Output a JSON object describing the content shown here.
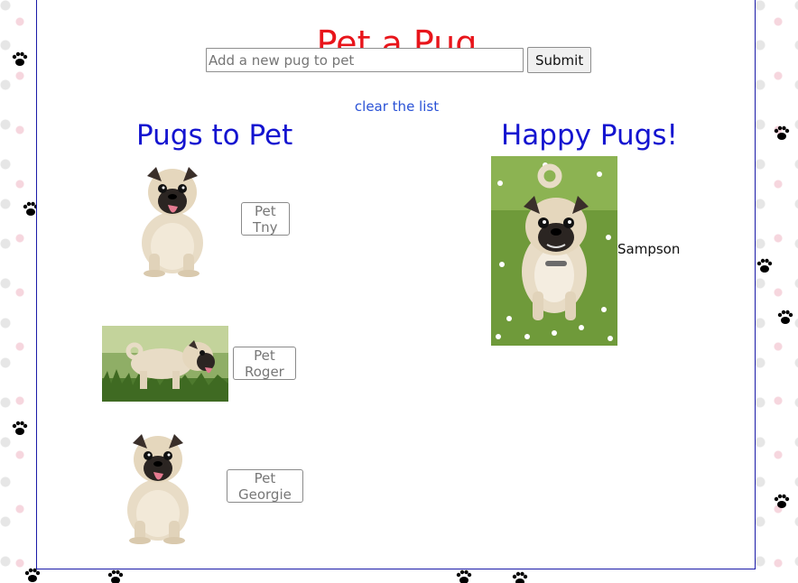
{
  "page": {
    "title": "Pet a Pug",
    "title_color": "#e8151b",
    "heading_color": "#1414d0"
  },
  "add_form": {
    "placeholder": "Add a new pug to pet",
    "value": "",
    "submit_label": "Submit"
  },
  "clear_link": "clear the list",
  "pugs_to_pet": {
    "heading": "Pugs to Pet",
    "items": [
      {
        "name": "Tny",
        "button_label": "Pet Tny",
        "photo": "sitting-pug-icon"
      },
      {
        "name": "Roger",
        "button_label": "Pet Roger",
        "photo": "standing-pug-grass-icon"
      },
      {
        "name": "Georgie",
        "button_label": "Pet Georgie",
        "photo": "sitting-pug-icon"
      }
    ]
  },
  "happy_pugs": {
    "heading": "Happy Pugs!",
    "items": [
      {
        "name": "Sampson",
        "photo": "pug-in-flower-field-icon"
      }
    ]
  }
}
